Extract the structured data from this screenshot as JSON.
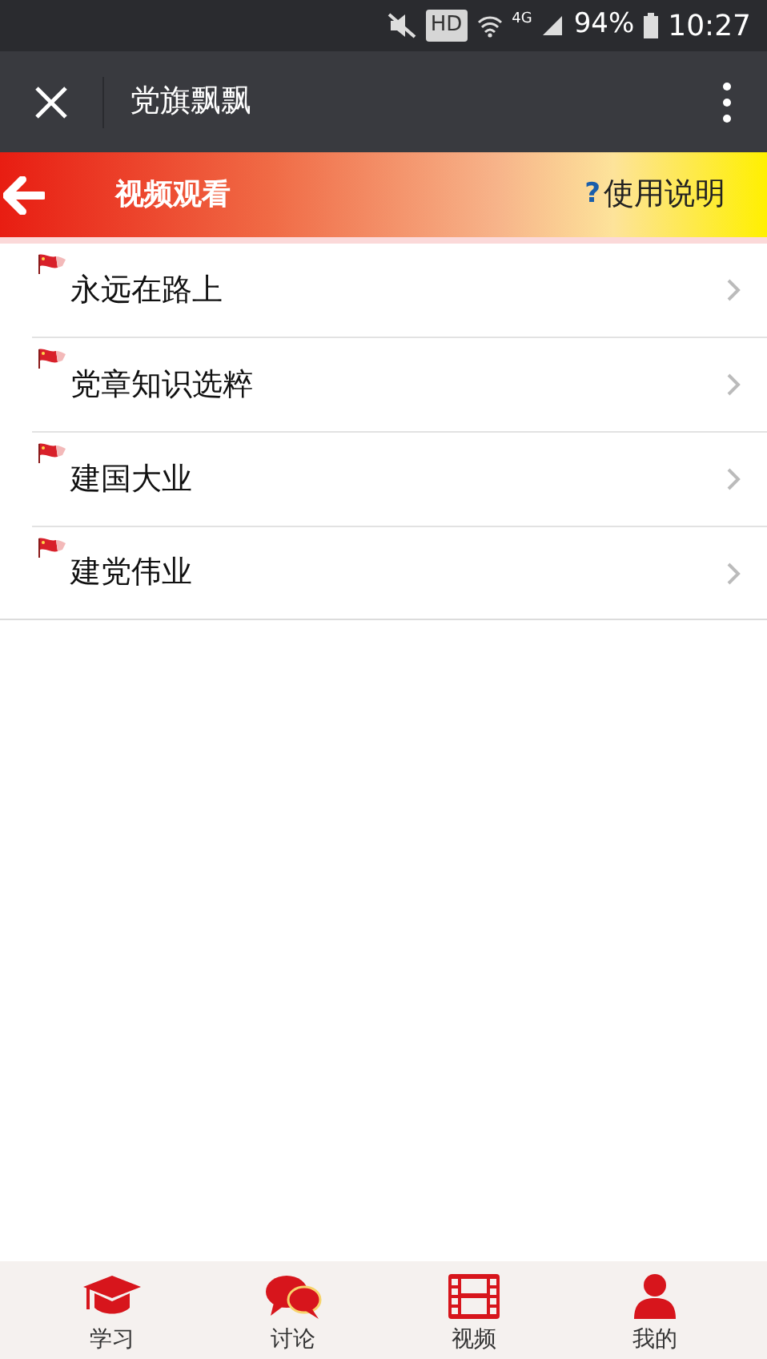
{
  "status_bar": {
    "network_badge": "HD",
    "network_type": "4G",
    "battery": "94%",
    "time": "10:27"
  },
  "app_bar": {
    "title": "党旗飘飘"
  },
  "banner": {
    "title": "视频观看",
    "help_mark": "?",
    "help_label": "使用说明"
  },
  "items": [
    {
      "label": "永远在路上"
    },
    {
      "label": "党章知识选粹"
    },
    {
      "label": "建国大业"
    },
    {
      "label": "建党伟业"
    }
  ],
  "tabs": [
    {
      "label": "学习"
    },
    {
      "label": "讨论"
    },
    {
      "label": "视频"
    },
    {
      "label": "我的"
    }
  ]
}
